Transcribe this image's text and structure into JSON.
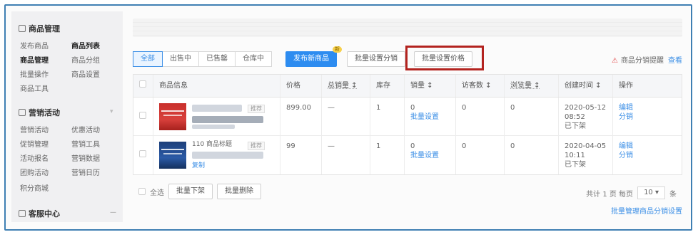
{
  "sidebar": {
    "groups": [
      {
        "title": "商品管理",
        "items": [
          [
            "发布商品",
            "商品列表"
          ],
          [
            "商品管理",
            "商品分组"
          ],
          [
            "批量操作",
            "商品设置"
          ],
          [
            "商品工具",
            ""
          ]
        ]
      },
      {
        "title": "营销活动",
        "items": [
          [
            "营销活动",
            "优惠活动"
          ],
          [
            "促销管理",
            "营销工具"
          ],
          [
            "活动报名",
            "营销数据"
          ],
          [
            "团购活动",
            "营销日历"
          ],
          [
            "积分商城",
            ""
          ]
        ]
      },
      {
        "title": "客服中心",
        "items": []
      }
    ]
  },
  "toolbar": {
    "tabs": [
      "全部",
      "出售中",
      "已售罄",
      "仓库中"
    ],
    "primary_label": "发布新商品",
    "primary_badge": "新",
    "btn_batch_label": "批量设置分销",
    "btn_highlight_label": "批量设置价格",
    "notice_text": "商品分销提醒",
    "notice_link": "查看"
  },
  "table": {
    "headers": [
      "",
      "商品信息",
      "价格",
      "总销量 ↕",
      "库存",
      "销量 ↕",
      "访客数 ↕",
      "浏览量 ↕",
      "创建时间 ↕",
      "操作"
    ],
    "rows": [
      {
        "tag": "推荐",
        "subtitle": "",
        "price": "899.00",
        "total_sales": "—",
        "stock": "1",
        "sales": "0",
        "sales_link": "批量设置",
        "visitors": "0",
        "views": "0",
        "created": [
          "2020-05-12",
          "08:52",
          "已下架"
        ],
        "actions": [
          "编辑",
          "分销"
        ]
      },
      {
        "tag": "推荐",
        "subtitle": "110 商品标题",
        "price": "99",
        "total_sales": "—",
        "stock": "1",
        "sales": "0",
        "sales_link": "批量设置",
        "visitors": "0",
        "views": "0",
        "created": [
          "2020-04-05",
          "10:11",
          "已下架"
        ],
        "actions": [
          "编辑",
          "分销"
        ],
        "extra_link": "复制"
      }
    ]
  },
  "footer": {
    "select_all": "全选",
    "btn_offshelf": "批量下架",
    "btn_delete": "批量删除",
    "pager_text": "共计 1 页  每页",
    "pager_value": "10",
    "pager_unit": "条",
    "bottom_link": "批量管理商品分销设置"
  },
  "colors": {
    "accent": "#2d8cf0",
    "highlight_border": "#b3231f",
    "frame": "#3f7fb3"
  }
}
